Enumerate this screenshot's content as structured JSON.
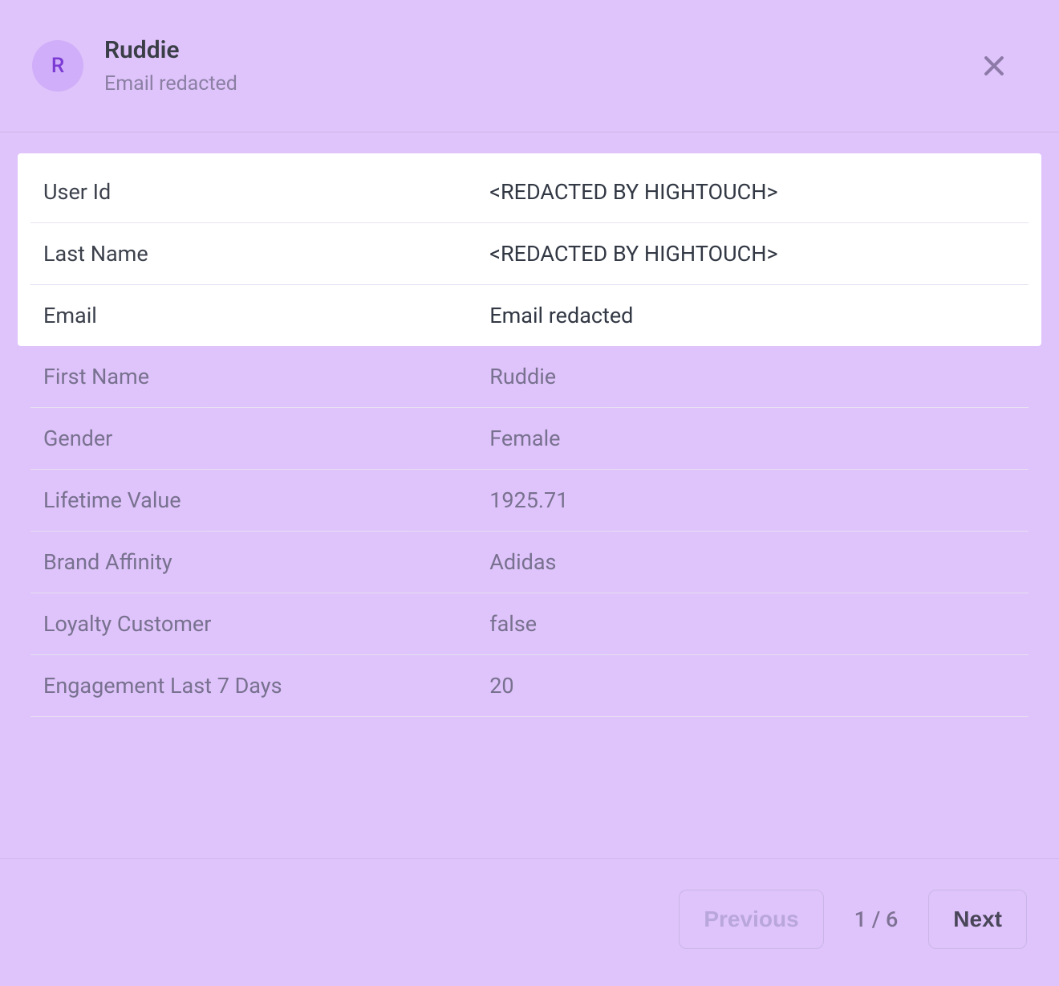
{
  "header": {
    "avatar_initial": "R",
    "name": "Ruddie",
    "email_line": "Email redacted"
  },
  "fields_highlighted": [
    {
      "label": "User Id",
      "value": "<REDACTED BY HIGHTOUCH>"
    },
    {
      "label": "Last Name",
      "value": "<REDACTED BY HIGHTOUCH>"
    },
    {
      "label": "Email",
      "value": "Email redacted"
    }
  ],
  "fields_other": [
    {
      "label": "First Name",
      "value": "Ruddie"
    },
    {
      "label": "Gender",
      "value": "Female"
    },
    {
      "label": "Lifetime Value",
      "value": "1925.71"
    },
    {
      "label": "Brand Affinity",
      "value": "Adidas"
    },
    {
      "label": "Loyalty Customer",
      "value": "false"
    },
    {
      "label": "Engagement Last 7 Days",
      "value": "20"
    }
  ],
  "footer": {
    "prev_label": "Previous",
    "next_label": "Next",
    "page_indicator": "1 / 6"
  }
}
